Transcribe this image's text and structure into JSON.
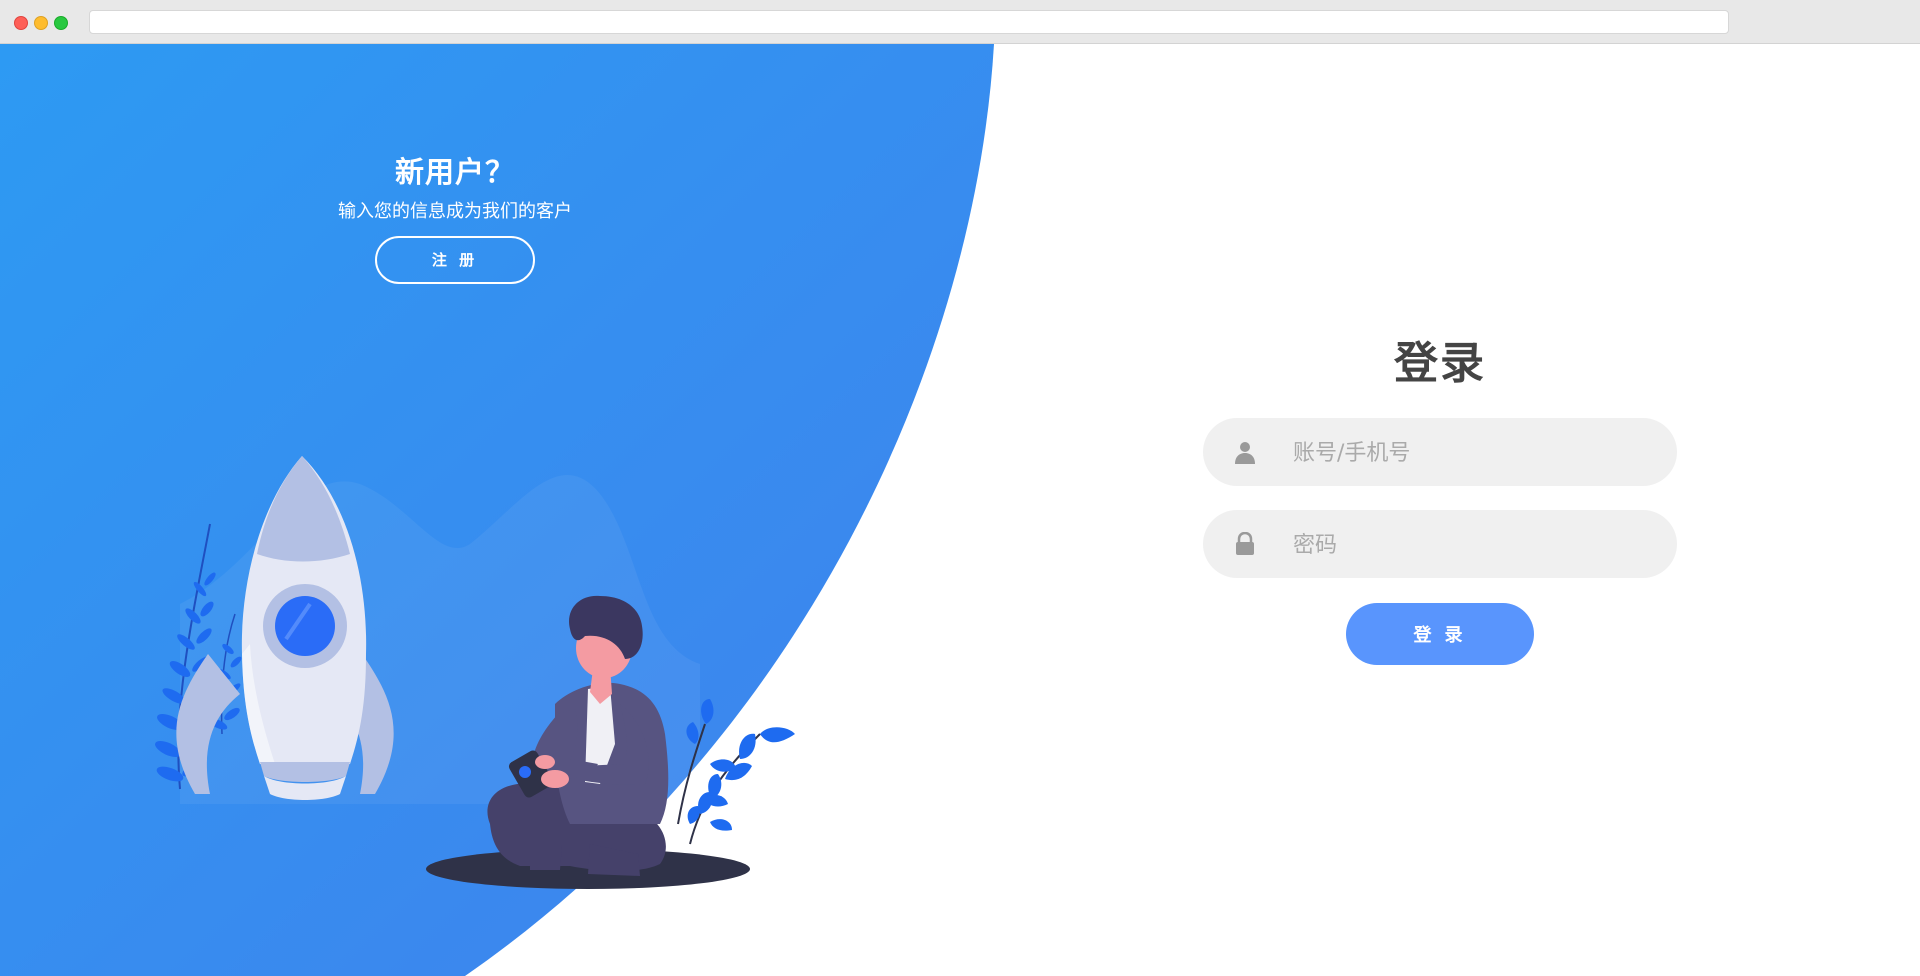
{
  "browser": {
    "address": ""
  },
  "promo": {
    "title": "新用户？",
    "subtitle": "输入您的信息成为我们的客户",
    "register_label": "注 册"
  },
  "login": {
    "title": "登录",
    "username_placeholder": "账号/手机号",
    "username_value": "",
    "password_placeholder": "密码",
    "password_value": "",
    "submit_label": "登 录",
    "username_icon": "user-icon",
    "password_icon": "lock-icon"
  },
  "colors": {
    "primary_blue": "#2e95f2",
    "accent_blue": "#5995fd",
    "field_bg": "#f0f0f0",
    "title_text": "#444444"
  }
}
